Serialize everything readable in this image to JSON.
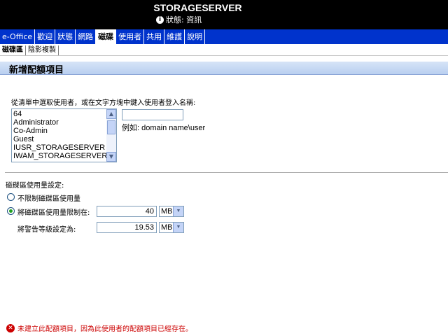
{
  "header": {
    "server_name": "STORAGESERVER",
    "status_text": "狀態: 資訊",
    "status_icon": "info-icon"
  },
  "nav": {
    "items": [
      {
        "label": "e-Office"
      },
      {
        "label": "歡迎"
      },
      {
        "label": "狀態"
      },
      {
        "label": "網路"
      },
      {
        "label": "磁碟"
      },
      {
        "label": "使用者"
      },
      {
        "label": "共用"
      },
      {
        "label": "維護"
      },
      {
        "label": "說明"
      }
    ],
    "active": "磁碟"
  },
  "subnav": {
    "items": [
      {
        "label": "磁碟區"
      },
      {
        "label": "陰影複製"
      }
    ],
    "active": "磁碟區"
  },
  "page_title": "新增配額項目",
  "user_select": {
    "prompt": "從清單中選取使用者，或在文字方塊中鍵入使用者登入名稱:",
    "users": [
      "64",
      "Administrator",
      "Co-Admin",
      "Guest",
      "IUSR_STORAGESERVER",
      "IWAM_STORAGESERVER"
    ],
    "username_value": "",
    "example": "例如: domain name\\user"
  },
  "quota": {
    "title": "磁碟區使用量設定:",
    "no_limit_label": "不限制磁碟區使用量",
    "limit_label": "將磁碟區使用量限制在:",
    "limit_value": "40",
    "limit_unit": "MB",
    "warning_label": "將警告等級設定為:",
    "warning_value": "19.53",
    "warning_unit": "MB",
    "selected": "limit"
  },
  "error": {
    "message": "未建立此配額項目，因為此使用者的配額項目已經存在。",
    "icon": "error-icon"
  },
  "colors": {
    "nav_bg": "#0033cc",
    "header_bg": "#000000",
    "error": "#cc0000"
  }
}
